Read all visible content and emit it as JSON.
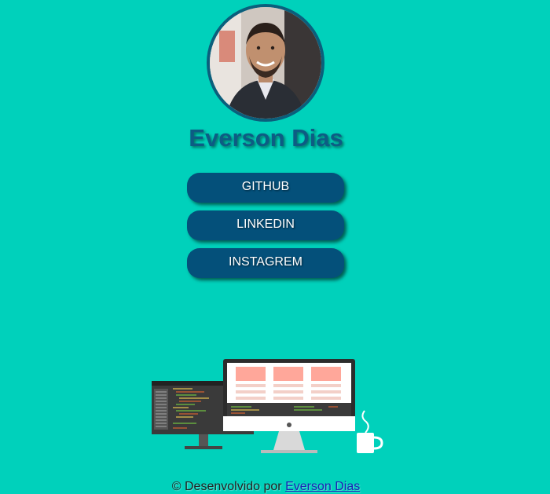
{
  "profile": {
    "name": "Everson Dias",
    "avatar_icon": "profile-photo"
  },
  "links": [
    {
      "label": "GITHUB"
    },
    {
      "label": "LINKEDIN"
    },
    {
      "label": "INSTAGREM"
    }
  ],
  "illustration": {
    "icon": "developer-workspace-illustration"
  },
  "footer": {
    "prefix": "© Desenvolvido por",
    "author": "Everson Dias"
  },
  "colors": {
    "background": "#00d1bb",
    "button": "#04507a",
    "name": "#0d5c84",
    "link": "#1b22b5"
  }
}
